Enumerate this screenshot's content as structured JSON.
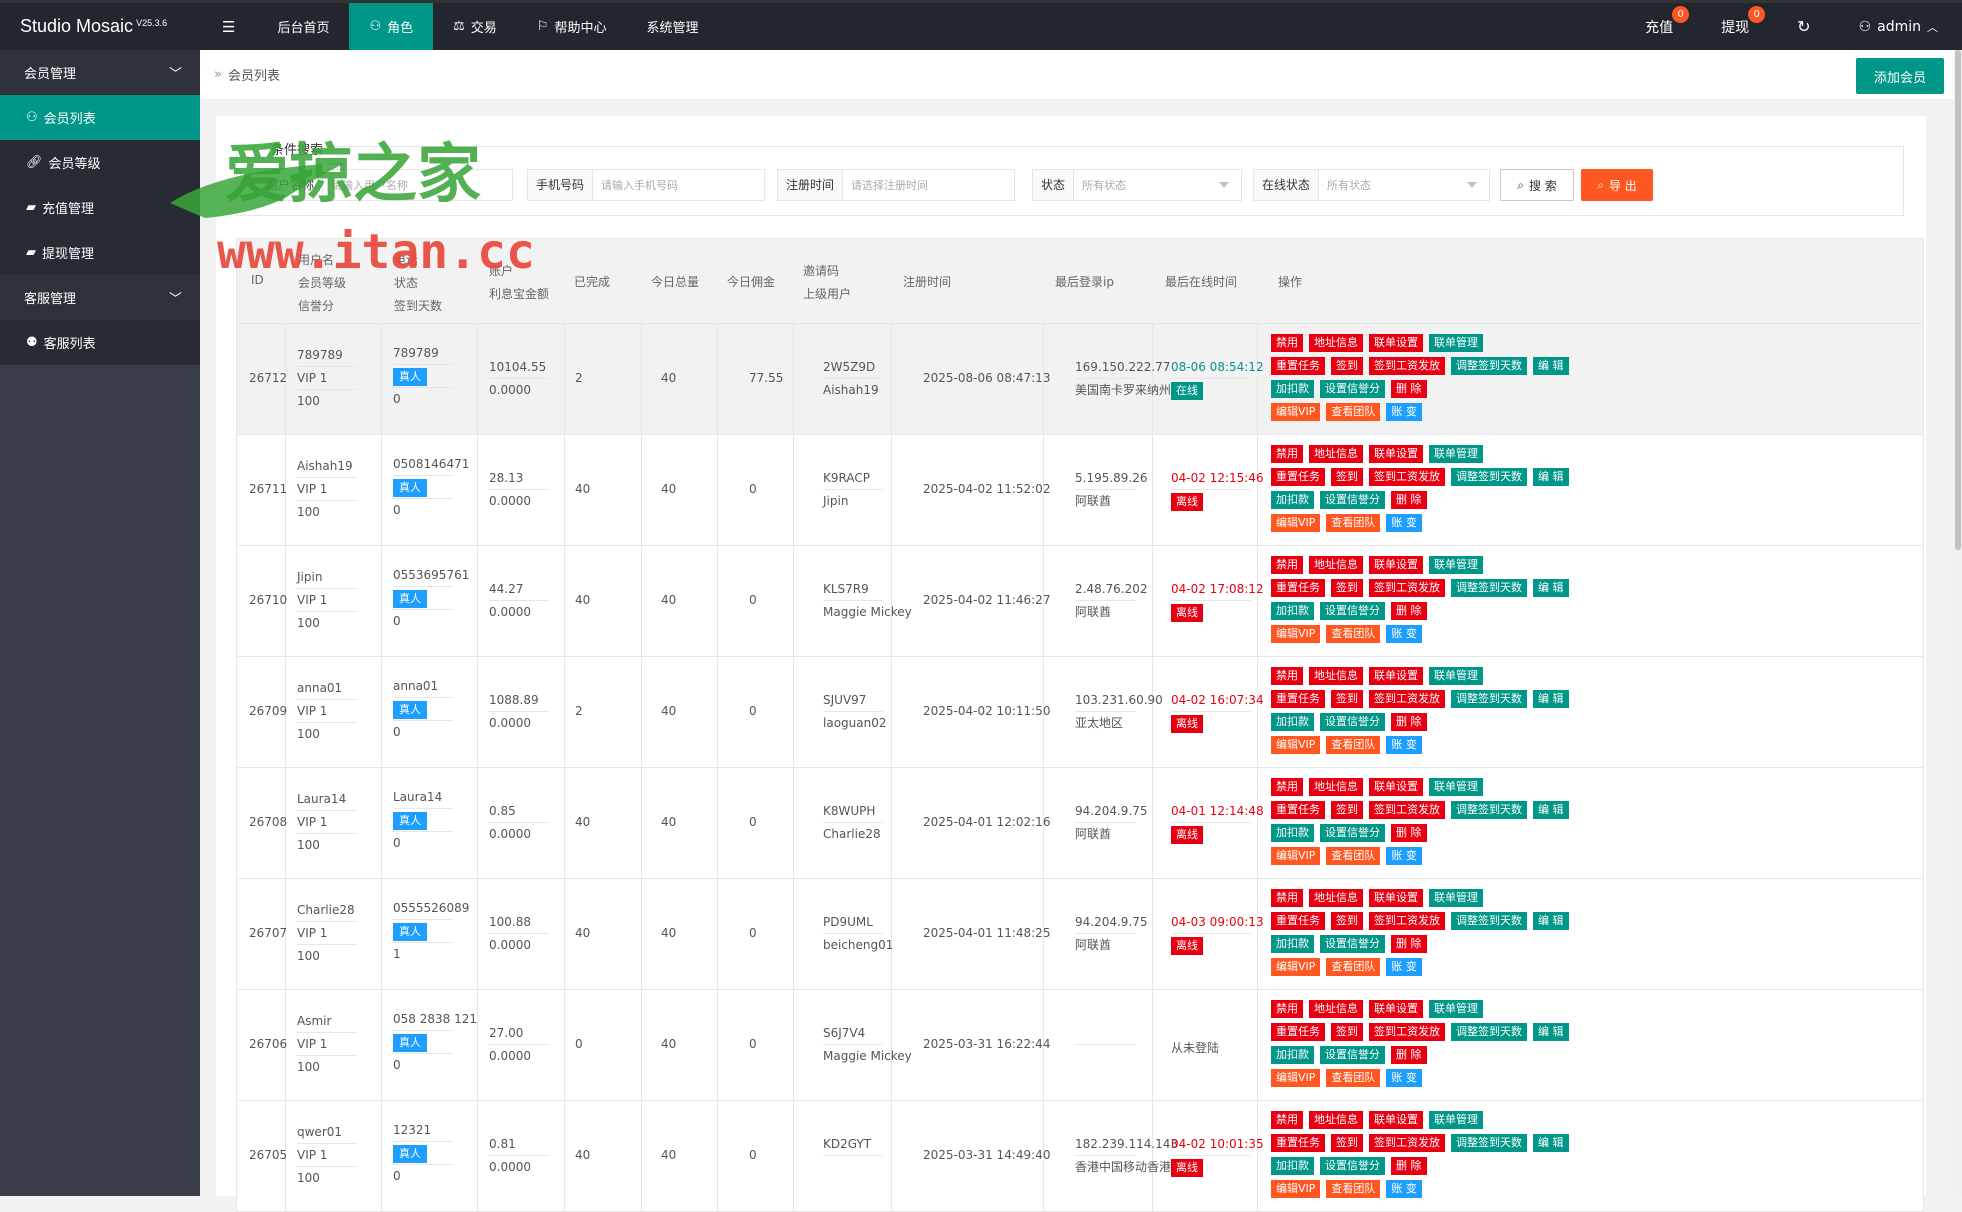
{
  "header": {
    "brand": "Studio Mosaic",
    "version": "V25.3.6",
    "menu_icon": "menu-icon",
    "nav": [
      {
        "label": "后台首页",
        "icon": ""
      },
      {
        "label": "角色",
        "icon": "user-icon"
      },
      {
        "label": "交易",
        "icon": "scale-icon"
      },
      {
        "label": "帮助中心",
        "icon": "flag-icon"
      },
      {
        "label": "系统管理",
        "icon": ""
      }
    ],
    "right": {
      "recharge": "充值",
      "recharge_count": "0",
      "withdraw": "提现",
      "withdraw_count": "0",
      "user": "admin"
    },
    "accent": "#009688"
  },
  "sidebar": {
    "groups": [
      {
        "label": "会员管理",
        "items": [
          "会员列表",
          "会员等级",
          "充值管理",
          "提现管理"
        ]
      },
      {
        "label": "客服管理",
        "items": [
          "客服列表"
        ]
      }
    ]
  },
  "breadcrumb": {
    "page": "会员列表",
    "add_button": "添加会员"
  },
  "search": {
    "legend": "条件搜索",
    "username_label": "用户名称",
    "username_placeholder": "请输入用户名称",
    "phone_label": "手机号码",
    "phone_placeholder": "请输入手机号码",
    "regtime_label": "注册时间",
    "regtime_placeholder": "请选择注册时间",
    "status_label": "状态",
    "status_value": "所有状态",
    "online_label": "在线状态",
    "online_value": "所有状态",
    "search_button": "搜 索",
    "export_button": "导 出"
  },
  "table": {
    "headers": {
      "id": "ID",
      "username": "用户名",
      "vip": "会员等级",
      "credit": "信誉分",
      "phone": "电话",
      "status": "状态",
      "sign_days": "签到天数",
      "balance": "账户",
      "interest": "利息宝金额",
      "done": "已完成",
      "today_total": "今日总量",
      "today_comm": "今日佣金",
      "invite": "邀请码",
      "parent": "上级用户",
      "regtime": "注册时间",
      "lastip": "最后登录ip",
      "lastonline": "最后在线时间",
      "ops": "操作"
    },
    "actions": [
      [
        "禁用",
        "地址信息",
        "联单设置",
        "联单管理"
      ],
      [
        "重置任务",
        "签到",
        "签到工资发放",
        "调整签到天数",
        "编 辑"
      ],
      [
        "加扣款",
        "设置信誉分",
        "删 除"
      ],
      [
        "编辑VIP",
        "查看团队",
        "账 变"
      ]
    ],
    "rows": [
      {
        "id": "26712",
        "username": "789789",
        "vip": "VIP 1",
        "credit": "100",
        "phone": "789789",
        "real": "真人",
        "sign": "0",
        "balance": "10104.55",
        "interest": "0.0000",
        "done": "2",
        "today_total": "40",
        "today_comm": "77.55",
        "invite": "2W5Z9D",
        "parent": "Aishah19",
        "regtime": "2025-08-06 08:47:13",
        "ip": "169.150.222.77",
        "region": "美国南卡罗来纳州",
        "lasttime": "08-06 08:54:12",
        "online": "在线"
      },
      {
        "id": "26711",
        "username": "Aishah19",
        "vip": "VIP 1",
        "credit": "100",
        "phone": "0508146471",
        "real": "真人",
        "sign": "0",
        "balance": "28.13",
        "interest": "0.0000",
        "done": "40",
        "today_total": "40",
        "today_comm": "0",
        "invite": "K9RACP",
        "parent": "Jipin",
        "regtime": "2025-04-02 11:52:02",
        "ip": "5.195.89.26",
        "region": "阿联酋",
        "lasttime": "04-02 12:15:46",
        "online": "离线"
      },
      {
        "id": "26710",
        "username": "Jipin",
        "vip": "VIP 1",
        "credit": "100",
        "phone": "0553695761",
        "real": "真人",
        "sign": "0",
        "balance": "44.27",
        "interest": "0.0000",
        "done": "40",
        "today_total": "40",
        "today_comm": "0",
        "invite": "KLS7R9",
        "parent": "Maggie Mickey",
        "regtime": "2025-04-02 11:46:27",
        "ip": "2.48.76.202",
        "region": "阿联酋",
        "lasttime": "04-02 17:08:12",
        "online": "离线"
      },
      {
        "id": "26709",
        "username": "anna01",
        "vip": "VIP 1",
        "credit": "100",
        "phone": "anna01",
        "real": "真人",
        "sign": "0",
        "balance": "1088.89",
        "interest": "0.0000",
        "done": "2",
        "today_total": "40",
        "today_comm": "0",
        "invite": "SJUV97",
        "parent": "laoguan02",
        "regtime": "2025-04-02 10:11:50",
        "ip": "103.231.60.90",
        "region": "亚太地区",
        "lasttime": "04-02 16:07:34",
        "online": "离线"
      },
      {
        "id": "26708",
        "username": "Laura14",
        "vip": "VIP 1",
        "credit": "100",
        "phone": "Laura14",
        "real": "真人",
        "sign": "0",
        "balance": "0.85",
        "interest": "0.0000",
        "done": "40",
        "today_total": "40",
        "today_comm": "0",
        "invite": "K8WUPH",
        "parent": "Charlie28",
        "regtime": "2025-04-01 12:02:16",
        "ip": "94.204.9.75",
        "region": "阿联酋",
        "lasttime": "04-01 12:14:48",
        "online": "离线"
      },
      {
        "id": "26707",
        "username": "Charlie28",
        "vip": "VIP 1",
        "credit": "100",
        "phone": "0555526089",
        "real": "真人",
        "sign": "1",
        "balance": "100.88",
        "interest": "0.0000",
        "done": "40",
        "today_total": "40",
        "today_comm": "0",
        "invite": "PD9UML",
        "parent": "beicheng01",
        "regtime": "2025-04-01 11:48:25",
        "ip": "94.204.9.75",
        "region": "阿联酋",
        "lasttime": "04-03 09:00:13",
        "online": "离线"
      },
      {
        "id": "26706",
        "username": "Asmir",
        "vip": "VIP 1",
        "credit": "100",
        "phone": "058 2838 121",
        "real": "真人",
        "sign": "0",
        "balance": "27.00",
        "interest": "0.0000",
        "done": "0",
        "today_total": "40",
        "today_comm": "0",
        "invite": "S6J7V4",
        "parent": "Maggie Mickey",
        "regtime": "2025-03-31 16:22:44",
        "ip": "",
        "region": "",
        "lasttime": "从未登陆",
        "online": ""
      },
      {
        "id": "26705",
        "username": "qwer01",
        "vip": "VIP 1",
        "credit": "100",
        "phone": "12321",
        "real": "真人",
        "sign": "0",
        "balance": "0.81",
        "interest": "0.0000",
        "done": "40",
        "today_total": "40",
        "today_comm": "0",
        "invite": "KD2GYT",
        "parent": "",
        "regtime": "2025-03-31 14:49:40",
        "ip": "182.239.114.143",
        "region": "香港中国移动香港",
        "lasttime": "04-02 10:01:35",
        "online": "离线"
      }
    ]
  },
  "watermark": {
    "title": "爱掠之家",
    "url": "www.itan.cc"
  },
  "colors": {
    "online": "#009688",
    "offline": "#e60012",
    "red": "#e60012",
    "green": "#009688",
    "orange": "#ff5722",
    "blue": "#1e9fff"
  }
}
